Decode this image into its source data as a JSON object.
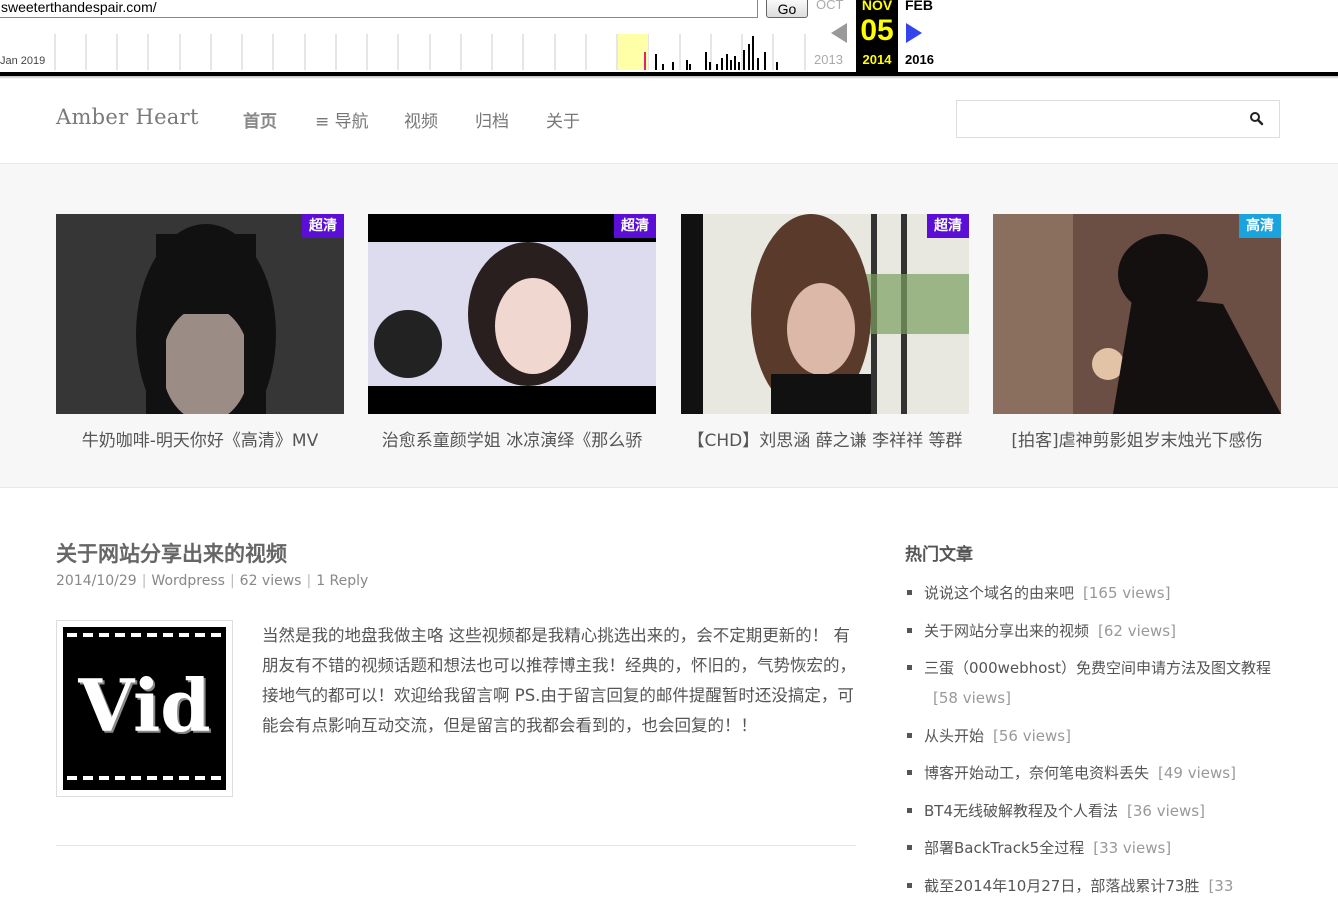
{
  "wayback": {
    "url": "sweeterthandespair.com/",
    "go_label": "Go",
    "left_date": "Jan 2019",
    "prev_month": "OCT",
    "prev_year": "2013",
    "current_month": "NOV",
    "current_day": "05",
    "current_year": "2014",
    "next_month": "FEB",
    "next_year": "2016"
  },
  "site": {
    "logo": "Amber Heart",
    "nav": [
      "首页",
      "≡ 导航",
      "视频",
      "归档",
      "关于"
    ],
    "search_icon": "search-icon"
  },
  "featured": [
    {
      "title": "牛奶咖啡-明天你好《高清》MV",
      "badge": "超清",
      "badge_color": "#5b0fd6"
    },
    {
      "title": "治愈系童颜学姐 冰凉演绎《那么骄",
      "badge": "超清",
      "badge_color": "#5b0fd6"
    },
    {
      "title": "【CHD】刘思涵 薛之谦 李祥祥 等群",
      "badge": "超清",
      "badge_color": "#5b0fd6"
    },
    {
      "title": "[拍客]虐神剪影姐岁末烛光下感伤",
      "badge": "高清",
      "badge_color": "#1aa3dd"
    }
  ],
  "post": {
    "title": "关于网站分享出来的视频",
    "date": "2014/10/29",
    "category": "Wordpress",
    "views": "62 views",
    "replies": "1 Reply",
    "thumb_text": "Vid",
    "excerpt": "当然是我的地盘我做主咯 这些视频都是我精心挑选出来的，会不定期更新的！ 有朋友有不错的视频话题和想法也可以推荐博主我！经典的，怀旧的，气势恢宏的，接地气的都可以！欢迎给我留言啊 PS.由于留言回复的邮件提醒暂时还没搞定，可能会有点影响互动交流，但是留言的我都会看到的，也会回复的！！"
  },
  "sidebar": {
    "title": "热门文章",
    "items": [
      {
        "title": "说说这个域名的由来吧",
        "views": "[165 views]"
      },
      {
        "title": "关于网站分享出来的视频",
        "views": "[62 views]"
      },
      {
        "title": "三蛋（000webhost）免费空间申请方法及图文教程",
        "views": "[58 views]"
      },
      {
        "title": "从头开始",
        "views": "[56 views]"
      },
      {
        "title": "博客开始动工，奈何笔电资料丢失",
        "views": "[49 views]"
      },
      {
        "title": "BT4无线破解教程及个人看法",
        "views": "[36 views]"
      },
      {
        "title": "部署BackTrack5全过程",
        "views": "[33 views]"
      },
      {
        "title": "截至2014年10月27日，部落战累计73胜",
        "views": "[33"
      }
    ]
  }
}
